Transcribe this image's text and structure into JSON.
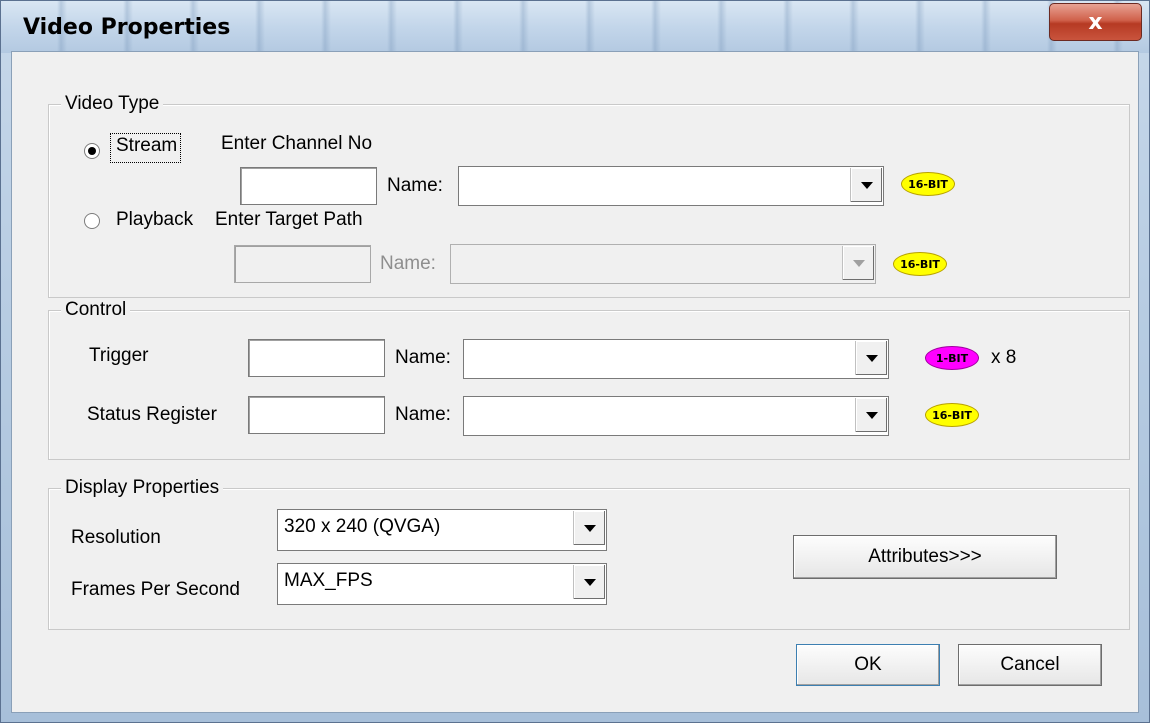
{
  "window": {
    "title": "Video Properties",
    "close_glyph": "x"
  },
  "video_type": {
    "legend": "Video Type",
    "stream_label": "Stream",
    "stream_selected": true,
    "enter_channel_label": "Enter Channel No",
    "stream_channel_value": "",
    "stream_name_label": "Name:",
    "stream_name_value": "",
    "stream_badge": "16-BIT",
    "playback_label": "Playback",
    "playback_selected": false,
    "enter_target_label": "Enter Target Path",
    "playback_path_value": "",
    "playback_name_label": "Name:",
    "playback_name_value": "",
    "playback_badge": "16-BIT"
  },
  "control": {
    "legend": "Control",
    "trigger_label": "Trigger",
    "trigger_value": "",
    "trigger_name_label": "Name:",
    "trigger_name_value": "",
    "trigger_badge": "1-BIT",
    "trigger_multiplier": "x 8",
    "status_label": "Status Register",
    "status_value": "",
    "status_name_label": "Name:",
    "status_name_value": "",
    "status_badge": "16-BIT"
  },
  "display": {
    "legend": "Display Properties",
    "resolution_label": "Resolution",
    "resolution_value": "320 x 240 (QVGA)",
    "fps_label": "Frames Per Second",
    "fps_value": "MAX_FPS",
    "attributes_button": "Attributes>>>"
  },
  "footer": {
    "ok_button": "OK",
    "cancel_button": "Cancel"
  },
  "colors": {
    "badge_16bit": "#ffff00",
    "badge_1bit": "#ff00ff",
    "close_button": "#c9543d"
  }
}
